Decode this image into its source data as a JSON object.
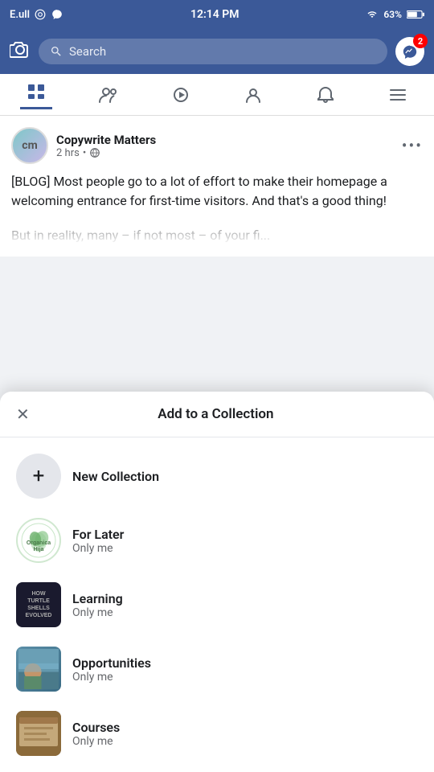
{
  "statusBar": {
    "carrier": "E.ull",
    "time": "12:14 PM",
    "wifi": "63%",
    "battery": "63%"
  },
  "header": {
    "searchPlaceholder": "Search",
    "messengerBadge": "2"
  },
  "nav": {
    "icons": [
      "news-feed",
      "friends",
      "watch",
      "profile",
      "notifications",
      "menu"
    ]
  },
  "post": {
    "authorName": "Copywrite Matters",
    "authorInitials": "cm",
    "timeAgo": "2 hrs",
    "privacy": "🌐",
    "textLine1": "[BLOG] Most people go to a lot of effort to make their homepage a welcoming entrance for first-time visitors. And that's a good thing!",
    "textLine2": "But in reality, many – if not most – of your fi..."
  },
  "bottomSheet": {
    "closeLabel": "✕",
    "title": "Add to a Collection",
    "newCollectionLabel": "New Collection",
    "collections": [
      {
        "name": "For Later",
        "privacy": "Only me",
        "thumbType": "for-later"
      },
      {
        "name": "Learning",
        "privacy": "Only me",
        "thumbType": "learning"
      },
      {
        "name": "Opportunities",
        "privacy": "Only me",
        "thumbType": "opportunities"
      },
      {
        "name": "Courses",
        "privacy": "Only me",
        "thumbType": "courses"
      }
    ]
  }
}
